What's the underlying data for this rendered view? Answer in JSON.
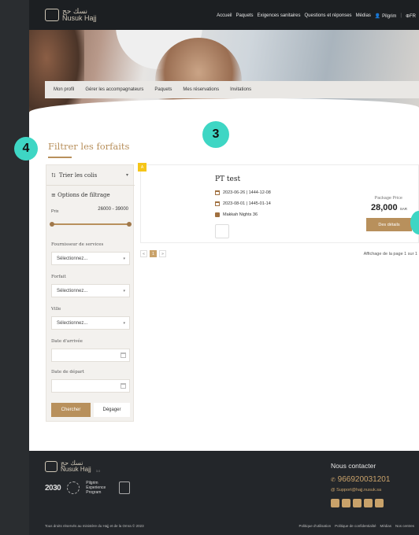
{
  "logo": {
    "arabic": "نسك حج",
    "english": "Nusuk Hajj"
  },
  "nav": {
    "items": [
      "Accueil",
      "Paquets",
      "Exigences sanitaires",
      "Questions et réponses",
      "Médias"
    ],
    "user": "Pilgrim",
    "lang": "FR"
  },
  "subnav": [
    "Mon profil",
    "Gérer les accompagnateurs",
    "Paquets",
    "Mes réservations",
    "Invitations"
  ],
  "badges": {
    "step3": "3",
    "step4": "4"
  },
  "filter": {
    "title": "Filtrer les forfaits",
    "sort_label": "Trier les colis",
    "options_label": "Options de filtrage",
    "price_label": "Prix",
    "price_range": "26000 - 39000",
    "provider_label": "Fournisseur de services",
    "provider_value": "Sélectionnez...",
    "package_label": "Forfait",
    "package_value": "Sélectionnez...",
    "city_label": "Ville",
    "city_value": "Sélectionnez...",
    "arrival_label": "Date d'arrivée",
    "departure_label": "Date de départ",
    "search_btn": "Chercher",
    "clear_btn": "Dégager"
  },
  "package": {
    "tag": "A",
    "title": "PT test",
    "date1": "2023-06-26 | 1444-12-08",
    "date2": "2023-08-01 | 1445-01-14",
    "nights": "Makkah Nights 36",
    "price_label": "Package Price",
    "price": "28,000",
    "currency": "SAR",
    "details_btn": "Des détails"
  },
  "pager": {
    "prev": "«",
    "current": "1",
    "next": "»",
    "info": "Affichage de la page 1 sur 1"
  },
  "footer": {
    "logo_arabic": "نسك حج",
    "logo_english": "Nusuk Hajj",
    "version": "3.0",
    "vision": "2030",
    "pep": "Pilgrim Experience Program",
    "contact_title": "Nous contacter",
    "phone": "966920031201",
    "email": "Support@hajj.nusuk.sa",
    "copyright": "Tous droits réservés au ministère du Hajj et de la Omra © 2023",
    "links": [
      "Politique d'utilisation",
      "Politique de confidentialité",
      "Médias",
      "Nos centres"
    ]
  },
  "colors": {
    "accent": "#b8905c",
    "badge": "#3ed6c4",
    "tag": "#f5c518",
    "dark": "#1f2225"
  }
}
